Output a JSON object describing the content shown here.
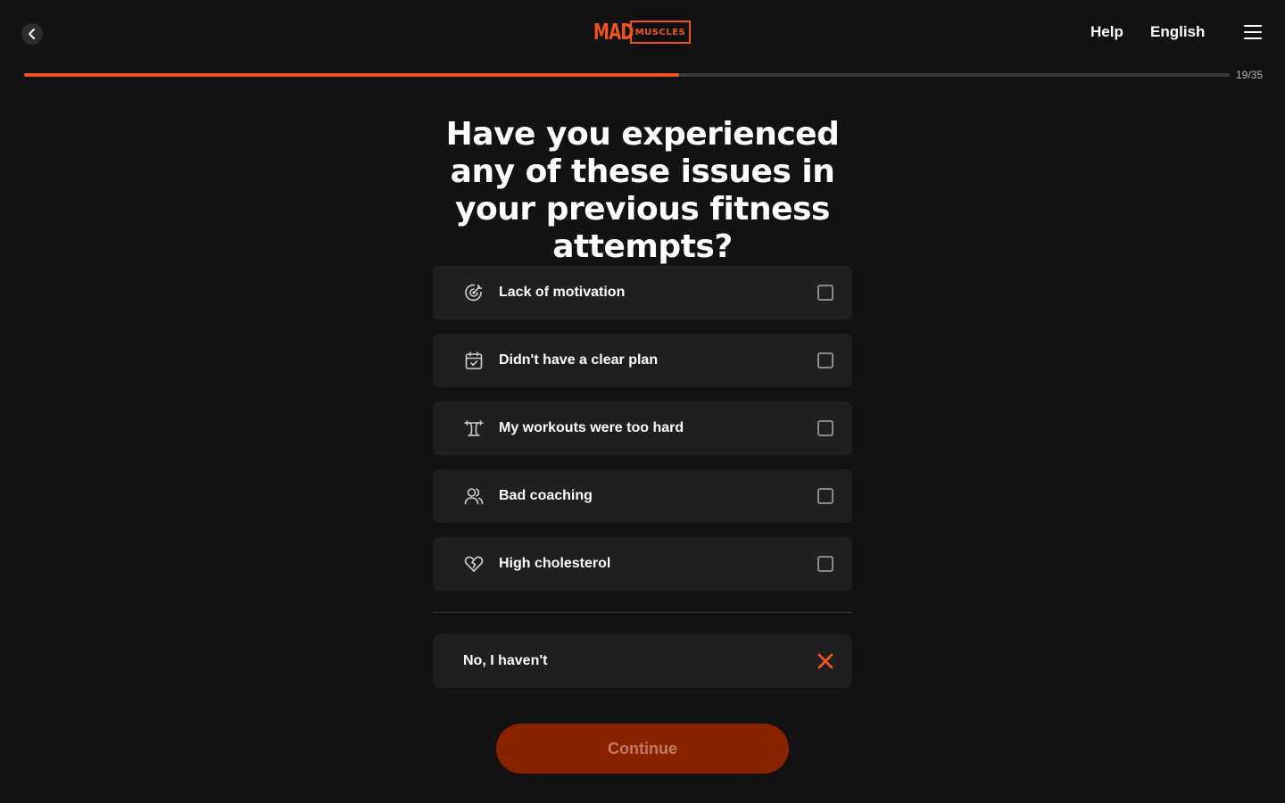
{
  "header": {
    "logo_mad": "MAD",
    "logo_muscles": "MUSCLES",
    "help_label": "Help",
    "language_label": "English"
  },
  "progress": {
    "text": "19/35",
    "fraction": 0.543
  },
  "question": {
    "title": "Have you experienced any of these issues in your previous fitness attempts?"
  },
  "options": [
    {
      "label": "Lack of motivation",
      "icon": "target-icon",
      "checked": false
    },
    {
      "label": "Didn't have a clear plan",
      "icon": "calendar-check-icon",
      "checked": false
    },
    {
      "label": "My workouts were too hard",
      "icon": "barbell-icon",
      "checked": false
    },
    {
      "label": "Bad coaching",
      "icon": "users-icon",
      "checked": false
    },
    {
      "label": "High cholesterol",
      "icon": "broken-heart-icon",
      "checked": false
    }
  ],
  "none_option": {
    "label": "No, I haven't",
    "icon": "close-icon"
  },
  "continue_button": {
    "label": "Continue"
  },
  "colors": {
    "background": "#121212",
    "card": "#1f1f1f",
    "accent": "#f0541d",
    "button_disabled": "#8a2200"
  }
}
